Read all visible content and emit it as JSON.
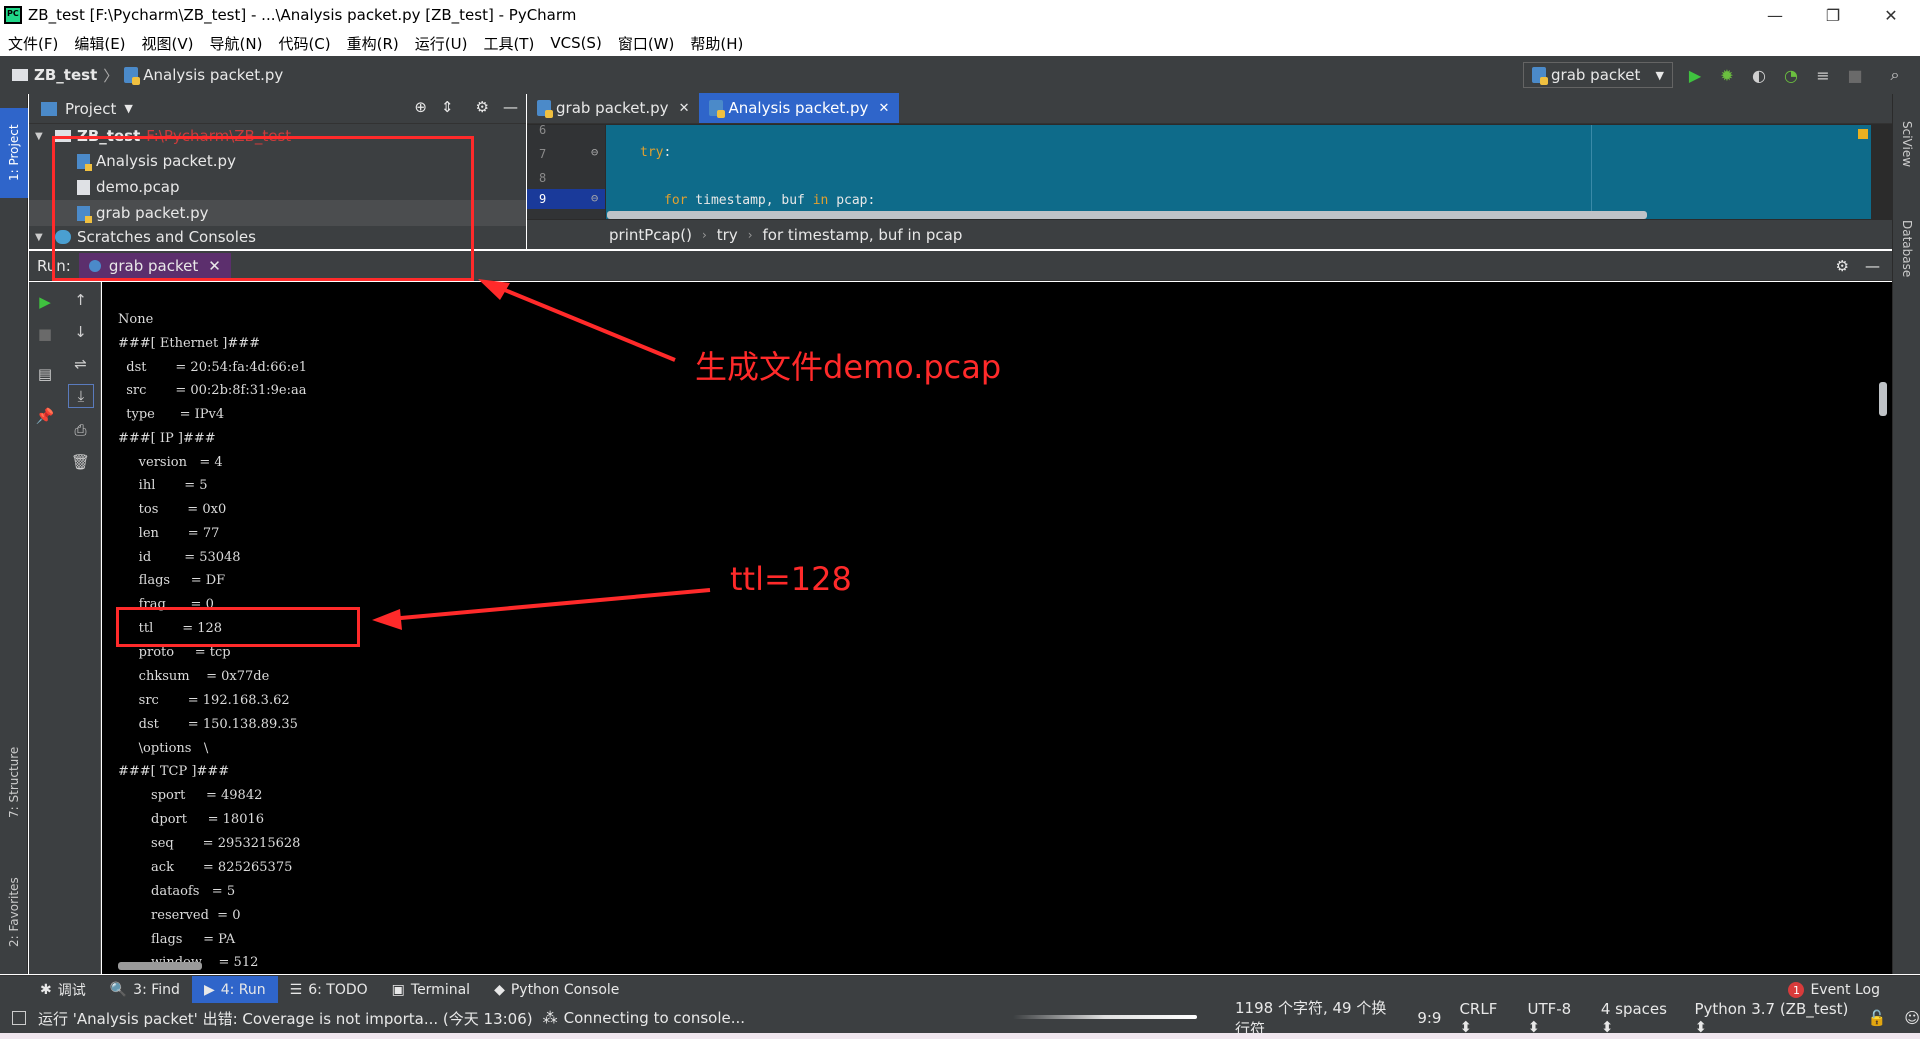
{
  "window": {
    "title": "ZB_test [F:\\Pycharm\\ZB_test] - ...\\Analysis packet.py [ZB_test] - PyCharm",
    "minimize": "—",
    "restore": "❐",
    "close": "✕"
  },
  "menu": [
    "文件(F)",
    "编辑(E)",
    "视图(V)",
    "导航(N)",
    "代码(C)",
    "重构(R)",
    "运行(U)",
    "工具(T)",
    "VCS(S)",
    "窗口(W)",
    "帮助(H)"
  ],
  "nav": {
    "project": "ZB_test",
    "sep": "〉",
    "file": "Analysis packet.py",
    "run_config": "grab packet",
    "run_config_arrow": "▼"
  },
  "left_tabs": {
    "project": "1: Project",
    "structure": "7: Structure",
    "favorites": "2: Favorites"
  },
  "right_tabs": {
    "sciview": "SciView",
    "database": "Database"
  },
  "project_panel": {
    "title": "Project",
    "title_arrow": "▼",
    "root_name": "ZB_test",
    "root_path": "F:\\Pycharm\\ZB_test",
    "files": [
      "Analysis packet.py",
      "demo.pcap",
      "grab packet.py"
    ],
    "scratches": "Scratches and Consoles"
  },
  "editor": {
    "tabs": [
      {
        "label": "grab packet.py",
        "close": "✕"
      },
      {
        "label": "Analysis packet.py",
        "close": "✕"
      }
    ],
    "line_numbers": [
      "6",
      "7",
      "8",
      "9"
    ],
    "lines": [
      {
        "kw": "try",
        "rest": ":"
      },
      {
        "kw": "for",
        "rest": " timestamp, buf ",
        "kw2": "in",
        "rest2": " pcap:"
      }
    ],
    "breadcrumbs": [
      "printPcap()",
      "try",
      "for timestamp, buf in pcap"
    ],
    "bc_sep": "›"
  },
  "run_panel": {
    "label": "Run:",
    "tab": "grab packet",
    "tab_close": "✕"
  },
  "console_lines": [
    "None",
    "###[ Ethernet ]###",
    "  dst       = 20:54:fa:4d:66:e1",
    "  src       = 00:2b:8f:31:9e:aa",
    "  type      = IPv4",
    "###[ IP ]###",
    "     version   = 4",
    "     ihl       = 5",
    "     tos       = 0x0",
    "     len       = 77",
    "     id        = 53048",
    "     flags     = DF",
    "     frag      = 0",
    "     ttl       = 128",
    "     proto     = tcp",
    "     chksum    = 0x77de",
    "     src       = 192.168.3.62",
    "     dst       = 150.138.89.35",
    "     \\options   \\",
    "###[ TCP ]###",
    "        sport     = 49842",
    "        dport     = 18016",
    "        seq       = 2953215628",
    "        ack       = 825265375",
    "        dataofs   = 5",
    "        reserved  = 0",
    "        flags     = PA",
    "        window    = 512"
  ],
  "annotations": {
    "file_note": "生成文件demo.pcap",
    "ttl_note": "ttl=128"
  },
  "tool_tabs": [
    {
      "icon": "✱",
      "label": "调试"
    },
    {
      "icon": "🔍",
      "label": "3: Find"
    },
    {
      "icon": "▶",
      "label": "4: Run"
    },
    {
      "icon": "☰",
      "label": "6: TODO"
    },
    {
      "icon": "▣",
      "label": "Terminal"
    },
    {
      "icon": "◆",
      "label": "Python Console"
    }
  ],
  "event_log": {
    "count": "1",
    "label": "Event Log"
  },
  "status": {
    "message": "运行 'Analysis packet' 出错: Coverage is not importa... (今天 13:06)",
    "connecting": "Connecting to console...",
    "chars": "1198 个字符, 49 个换行符",
    "position": "9:9",
    "line_sep": "CRLF ⬍",
    "encoding": "UTF-8 ⬍",
    "indent": "4 spaces ⬍",
    "interpreter": "Python 3.7 (ZB_test) ⬍"
  },
  "colors": {
    "accent": "#2f65ca",
    "annotation": "#ff2a2a",
    "keyword": "#e0a030",
    "panel": "#3c3f41"
  }
}
